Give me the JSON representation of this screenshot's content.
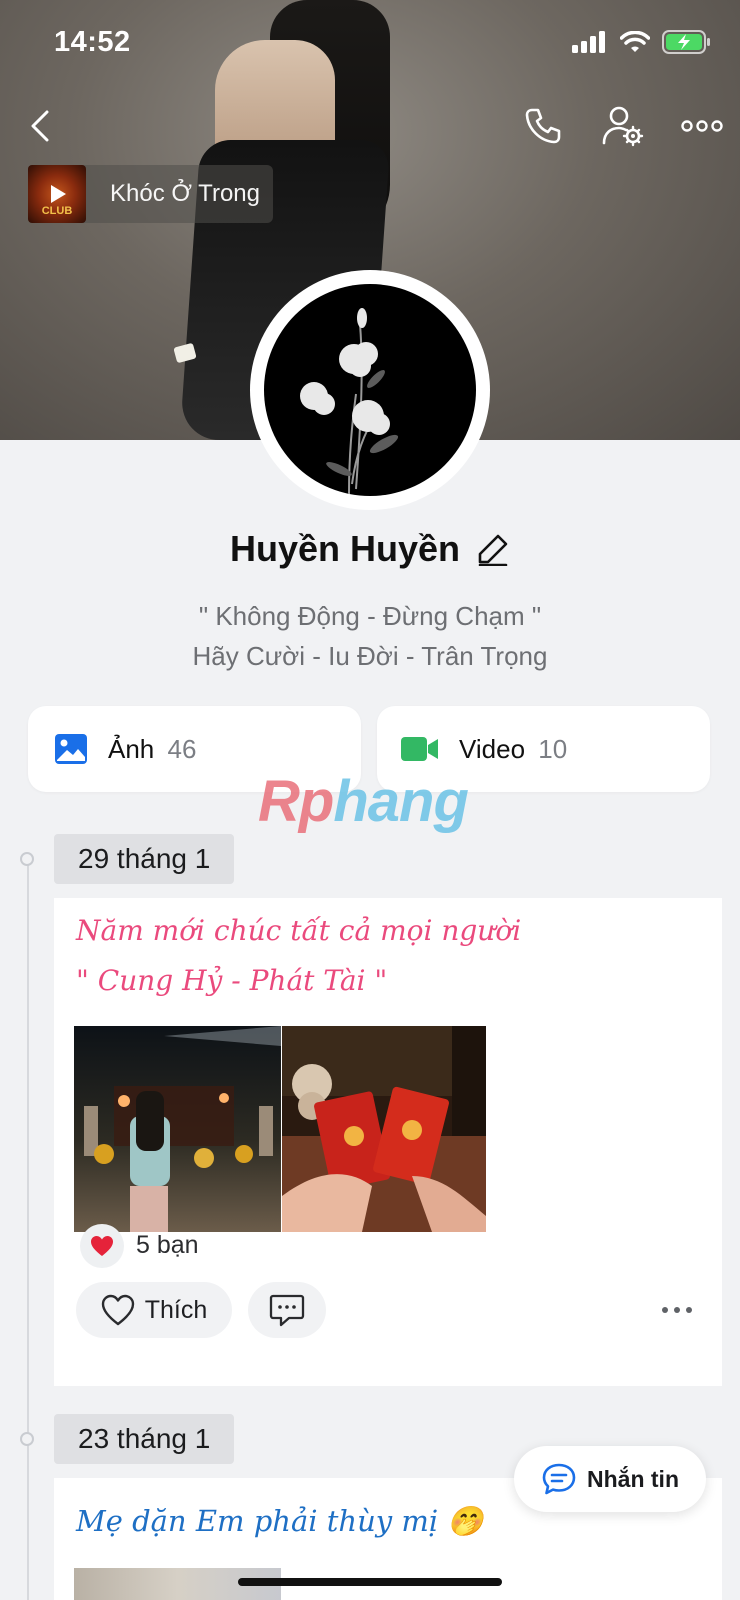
{
  "status_bar": {
    "time": "14:52"
  },
  "music": {
    "title": "Khóc Ở Trong",
    "art_text": "CLUB"
  },
  "profile": {
    "name": "Huyền Huyền",
    "bio_line1": "\" Không Động - Đừng Chạm \"",
    "bio_line2": "Hãy Cười - Iu Đời - Trân Trọng"
  },
  "media": {
    "photos": {
      "label": "Ảnh",
      "count": "46",
      "icon_color": "#1a6fe8"
    },
    "videos": {
      "label": "Video",
      "count": "10",
      "icon_color": "#33b864"
    }
  },
  "watermark": {
    "part1": "Rp",
    "part2": "hang"
  },
  "posts": [
    {
      "date": "29 tháng 1",
      "caption_line1": "Năm mới chúc tất cả mọi người",
      "caption_line2": "\" Cung Hỷ - Phát Tài \"",
      "reaction_count": "5 bạn",
      "like_label": "Thích"
    },
    {
      "date": "23 tháng 1",
      "caption": "Mẹ dặn Em phải thùy mị 🤭"
    }
  ],
  "message_button": {
    "label": "Nhắn tin"
  },
  "colors": {
    "accent_blue": "#1a6fe8",
    "caption_pink": "#ea4a7d",
    "caption_blue": "#1e6fc4",
    "heart_red": "#e5233a"
  }
}
